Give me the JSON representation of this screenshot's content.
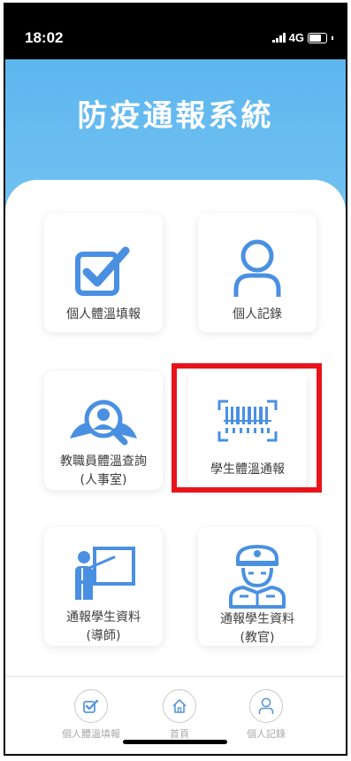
{
  "status_bar": {
    "time": "18:02",
    "network": "4G"
  },
  "header": {
    "title": "防疫通報系統"
  },
  "menu": {
    "personal_temp_report": "個人體溫填報",
    "personal_record": "個人記錄",
    "staff_temp_query_line1": "教職員體溫查詢",
    "staff_temp_query_line2": "(人事室)",
    "student_temp_report": "學生體溫通報",
    "student_info_tutor_line1": "通報學生資料",
    "student_info_tutor_line2": "(導師)",
    "student_info_officer_line1": "通報學生資料",
    "student_info_officer_line2": "(教官)"
  },
  "tabbar": {
    "personal_temp_report": "個人體溫填報",
    "home": "首頁",
    "personal_record": "個人記錄"
  },
  "colors": {
    "accent": "#4a90e2",
    "hero": "#6cc0f1",
    "highlight": "#e8141c"
  }
}
